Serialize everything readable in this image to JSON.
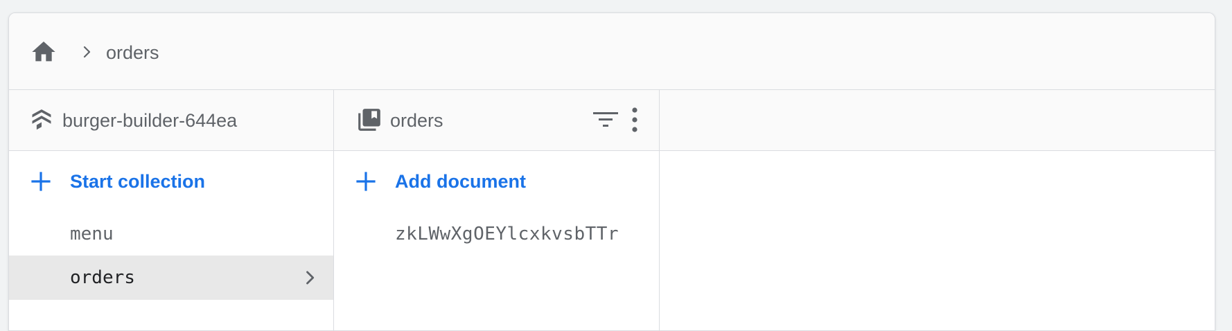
{
  "breadcrumb": {
    "home_icon": "home-icon",
    "separator_icon": "chevron-right-icon",
    "current": "orders"
  },
  "root_panel": {
    "icon": "firestore-stack-icon",
    "title": "burger-builder-644ea",
    "add_label": "Start collection",
    "items": [
      {
        "label": "menu",
        "selected": false
      },
      {
        "label": "orders",
        "selected": true
      }
    ]
  },
  "collection_panel": {
    "icon": "collection-icon",
    "title": "orders",
    "filter_icon": "filter-icon",
    "more_icon": "more-vert-icon",
    "add_label": "Add document",
    "documents": [
      {
        "id": "zkLWwXgOEYlcxkvsbTTr"
      }
    ]
  },
  "colors": {
    "accent": "#1a73e8",
    "text_secondary": "#5f6368",
    "selected_bg": "#e8e8e8",
    "border": "#dadce0"
  }
}
